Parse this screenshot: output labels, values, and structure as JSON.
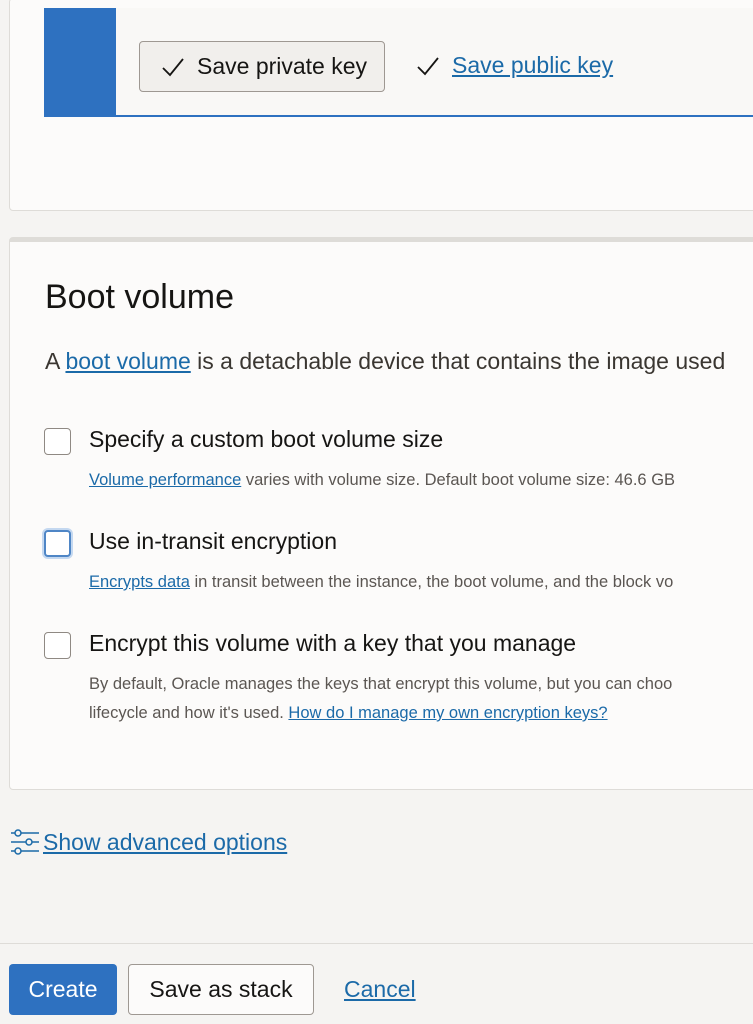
{
  "ssh_keys": {
    "save_private_label": "Save private key",
    "save_public_label": "Save public key",
    "check_icon": "check-icon"
  },
  "boot_volume": {
    "title": "Boot volume",
    "description_prefix": "A ",
    "description_link": "boot volume",
    "description_suffix": " is a detachable device that contains the image used",
    "options": [
      {
        "label": "Specify a custom boot volume size",
        "help_link": "Volume performance",
        "help_text": " varies with volume size. Default boot volume size: 46.6 GB",
        "checked": false
      },
      {
        "label": "Use in-transit encryption",
        "help_link": "Encrypts data",
        "help_text": " in transit between the instance, the boot volume, and the block vo",
        "checked": false,
        "focused": true
      },
      {
        "label": "Encrypt this volume with a key that you manage",
        "help_text_line1": "By default, Oracle manages the keys that encrypt this volume, but you can choo",
        "help_text_line2": "lifecycle and how it's used. ",
        "help_link": "How do I manage my own encryption keys?",
        "checked": false
      }
    ]
  },
  "advanced": {
    "label": "Show advanced options",
    "icon": "sliders-icon"
  },
  "footer": {
    "create_label": "Create",
    "save_stack_label": "Save as stack",
    "cancel_label": "Cancel"
  },
  "colors": {
    "accent": "#2e71c0",
    "link": "#1b6aa8",
    "border": "#dedcd8",
    "background": "#f5f4f2"
  }
}
